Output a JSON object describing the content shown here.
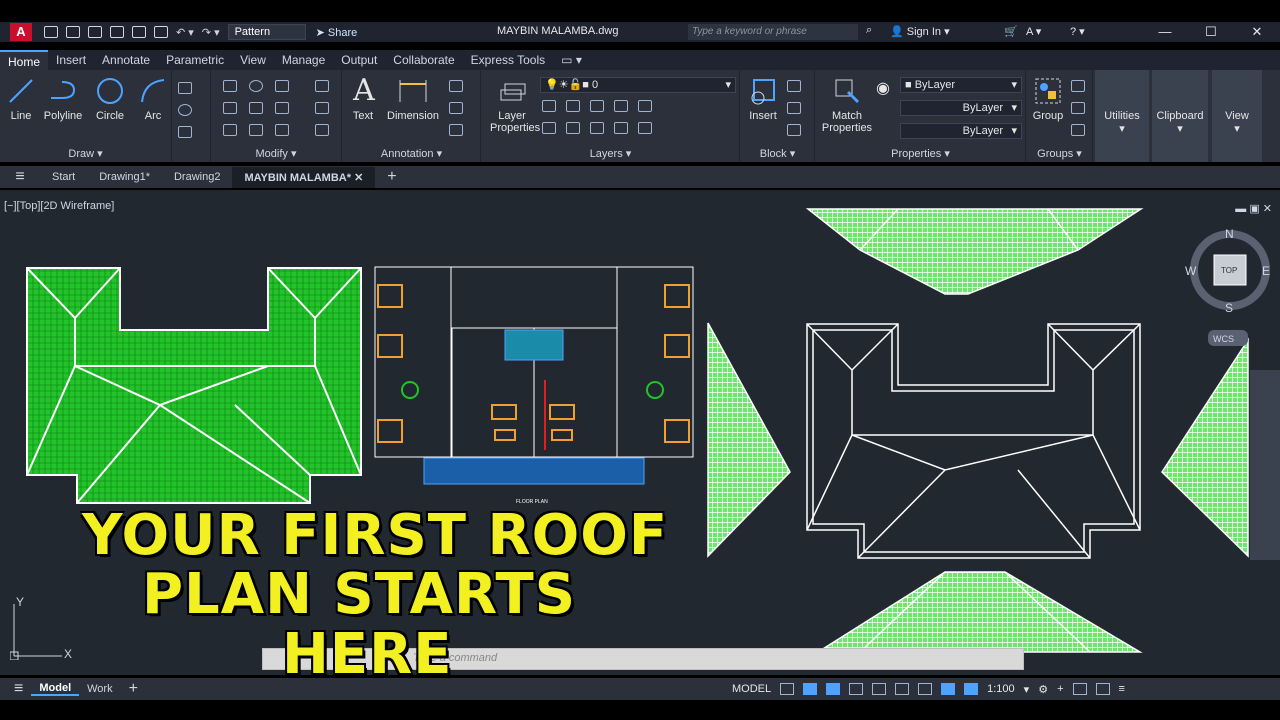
{
  "app": {
    "logo": "A",
    "workspace": "Pattern",
    "share": "Share",
    "doc_title": "MAYBIN MALAMBA.dwg",
    "search_placeholder": "Type a keyword or phrase",
    "signin": "Sign In"
  },
  "ribbon_tabs": [
    "Home",
    "Insert",
    "Annotate",
    "Parametric",
    "View",
    "Manage",
    "Output",
    "Collaborate",
    "Express Tools"
  ],
  "panels": {
    "draw": {
      "title": "Draw",
      "tools": [
        "Line",
        "Polyline",
        "Circle",
        "Arc"
      ]
    },
    "modify": {
      "title": "Modify"
    },
    "annotation": {
      "title": "Annotation",
      "tools": [
        "Text",
        "Dimension"
      ]
    },
    "layers": {
      "title": "Layers",
      "tool": "Layer Properties",
      "current_layer": "0"
    },
    "block": {
      "title": "Block",
      "tool": "Insert"
    },
    "properties": {
      "title": "Properties",
      "tool": "Match Properties",
      "color": "ByLayer",
      "linetype": "ByLayer",
      "lineweight": "ByLayer"
    },
    "groups": {
      "title": "Groups",
      "tool": "Group"
    },
    "utilities": {
      "title": "Utilities"
    },
    "clipboard": {
      "title": "Clipboard"
    },
    "view": {
      "title": "View"
    }
  },
  "doc_tabs": [
    "Start",
    "Drawing1*",
    "Drawing2",
    "MAYBIN MALAMBA*"
  ],
  "viewport": {
    "label": "[−][Top][2D Wireframe]"
  },
  "viewcube": {
    "top": "TOP",
    "n": "N",
    "s": "S",
    "e": "E",
    "w": "W",
    "wcs": "WCS"
  },
  "ucs": {
    "x": "X",
    "y": "Y"
  },
  "floorplan_title": "FLOOR PLAN",
  "command_hint": "Type a command",
  "overlay": {
    "line1": "YOUR FIRST ROOF",
    "line2": "PLAN STARTS",
    "line3": "HERE"
  },
  "status": {
    "model_tab": "Model",
    "work_tab": "Work",
    "model_label": "MODEL",
    "scale": "1:100"
  },
  "colors": {
    "hatch": "#22c42a",
    "accent": "#4da3ff",
    "overlay": "#f3f021"
  }
}
